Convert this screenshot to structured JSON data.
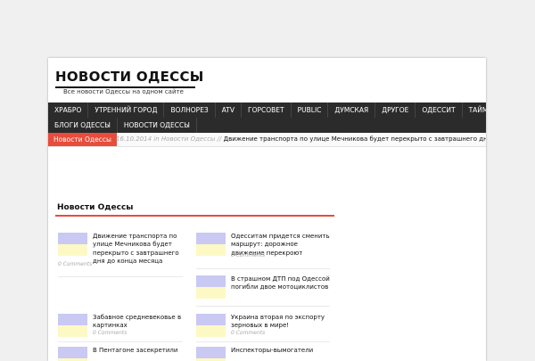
{
  "site": {
    "title": "НОВОСТИ ОДЕССЫ",
    "tagline": "Все новости Одессы на одном сайте"
  },
  "nav": {
    "row1": [
      "ХРАБРО",
      "УТРЕННИЙ ГОРОД",
      "ВОЛНОРЕЗ",
      "ATV",
      "ГОРСОВЕТ",
      "PUBLIC",
      "ДУМСКАЯ",
      "ДРУГОЕ",
      "ОДЕССИТ",
      "ТАЙМЕР"
    ],
    "row2": [
      "БЛОГИ ОДЕССЫ",
      "НОВОСТИ ОДЕССЫ"
    ]
  },
  "ticker": {
    "label": "Новости Одессы",
    "meta": "16.10.2014 in Новости Одессы //",
    "headline": "Движение транспорта по улице Мечникова будет перекрыто с завтрашнего дня до"
  },
  "section": {
    "title": "Новости Одессы"
  },
  "posts": [
    {
      "title": "Движение транспорта по улице Мечникова будет перекрыто с завтрашнего дня до конца месяца",
      "meta": "0 Comments"
    },
    {
      "title": "Одесситам придется сменить маршрут: дорожное движение перекроют",
      "meta": "0 Comments"
    },
    {
      "title": "В страшном ДТП под Одессой погибли двое мотоциклистов",
      "meta": "0 Comments"
    },
    {
      "title": "Забавное средневековье в картинках",
      "meta": "0 Comments"
    },
    {
      "title": "Украина вторая по экспорту зерновых в мире!",
      "meta": "0 Comments"
    },
    {
      "title": "В Пентагоне засекретили",
      "meta": ""
    },
    {
      "title": "Инспекторы-вымогатели",
      "meta": ""
    }
  ],
  "colors": {
    "accent": "#e74c3c",
    "nav_bg": "#2b2b2b",
    "thumb_top": "#c9c9f4",
    "thumb_bottom": "#fdf9c4"
  }
}
